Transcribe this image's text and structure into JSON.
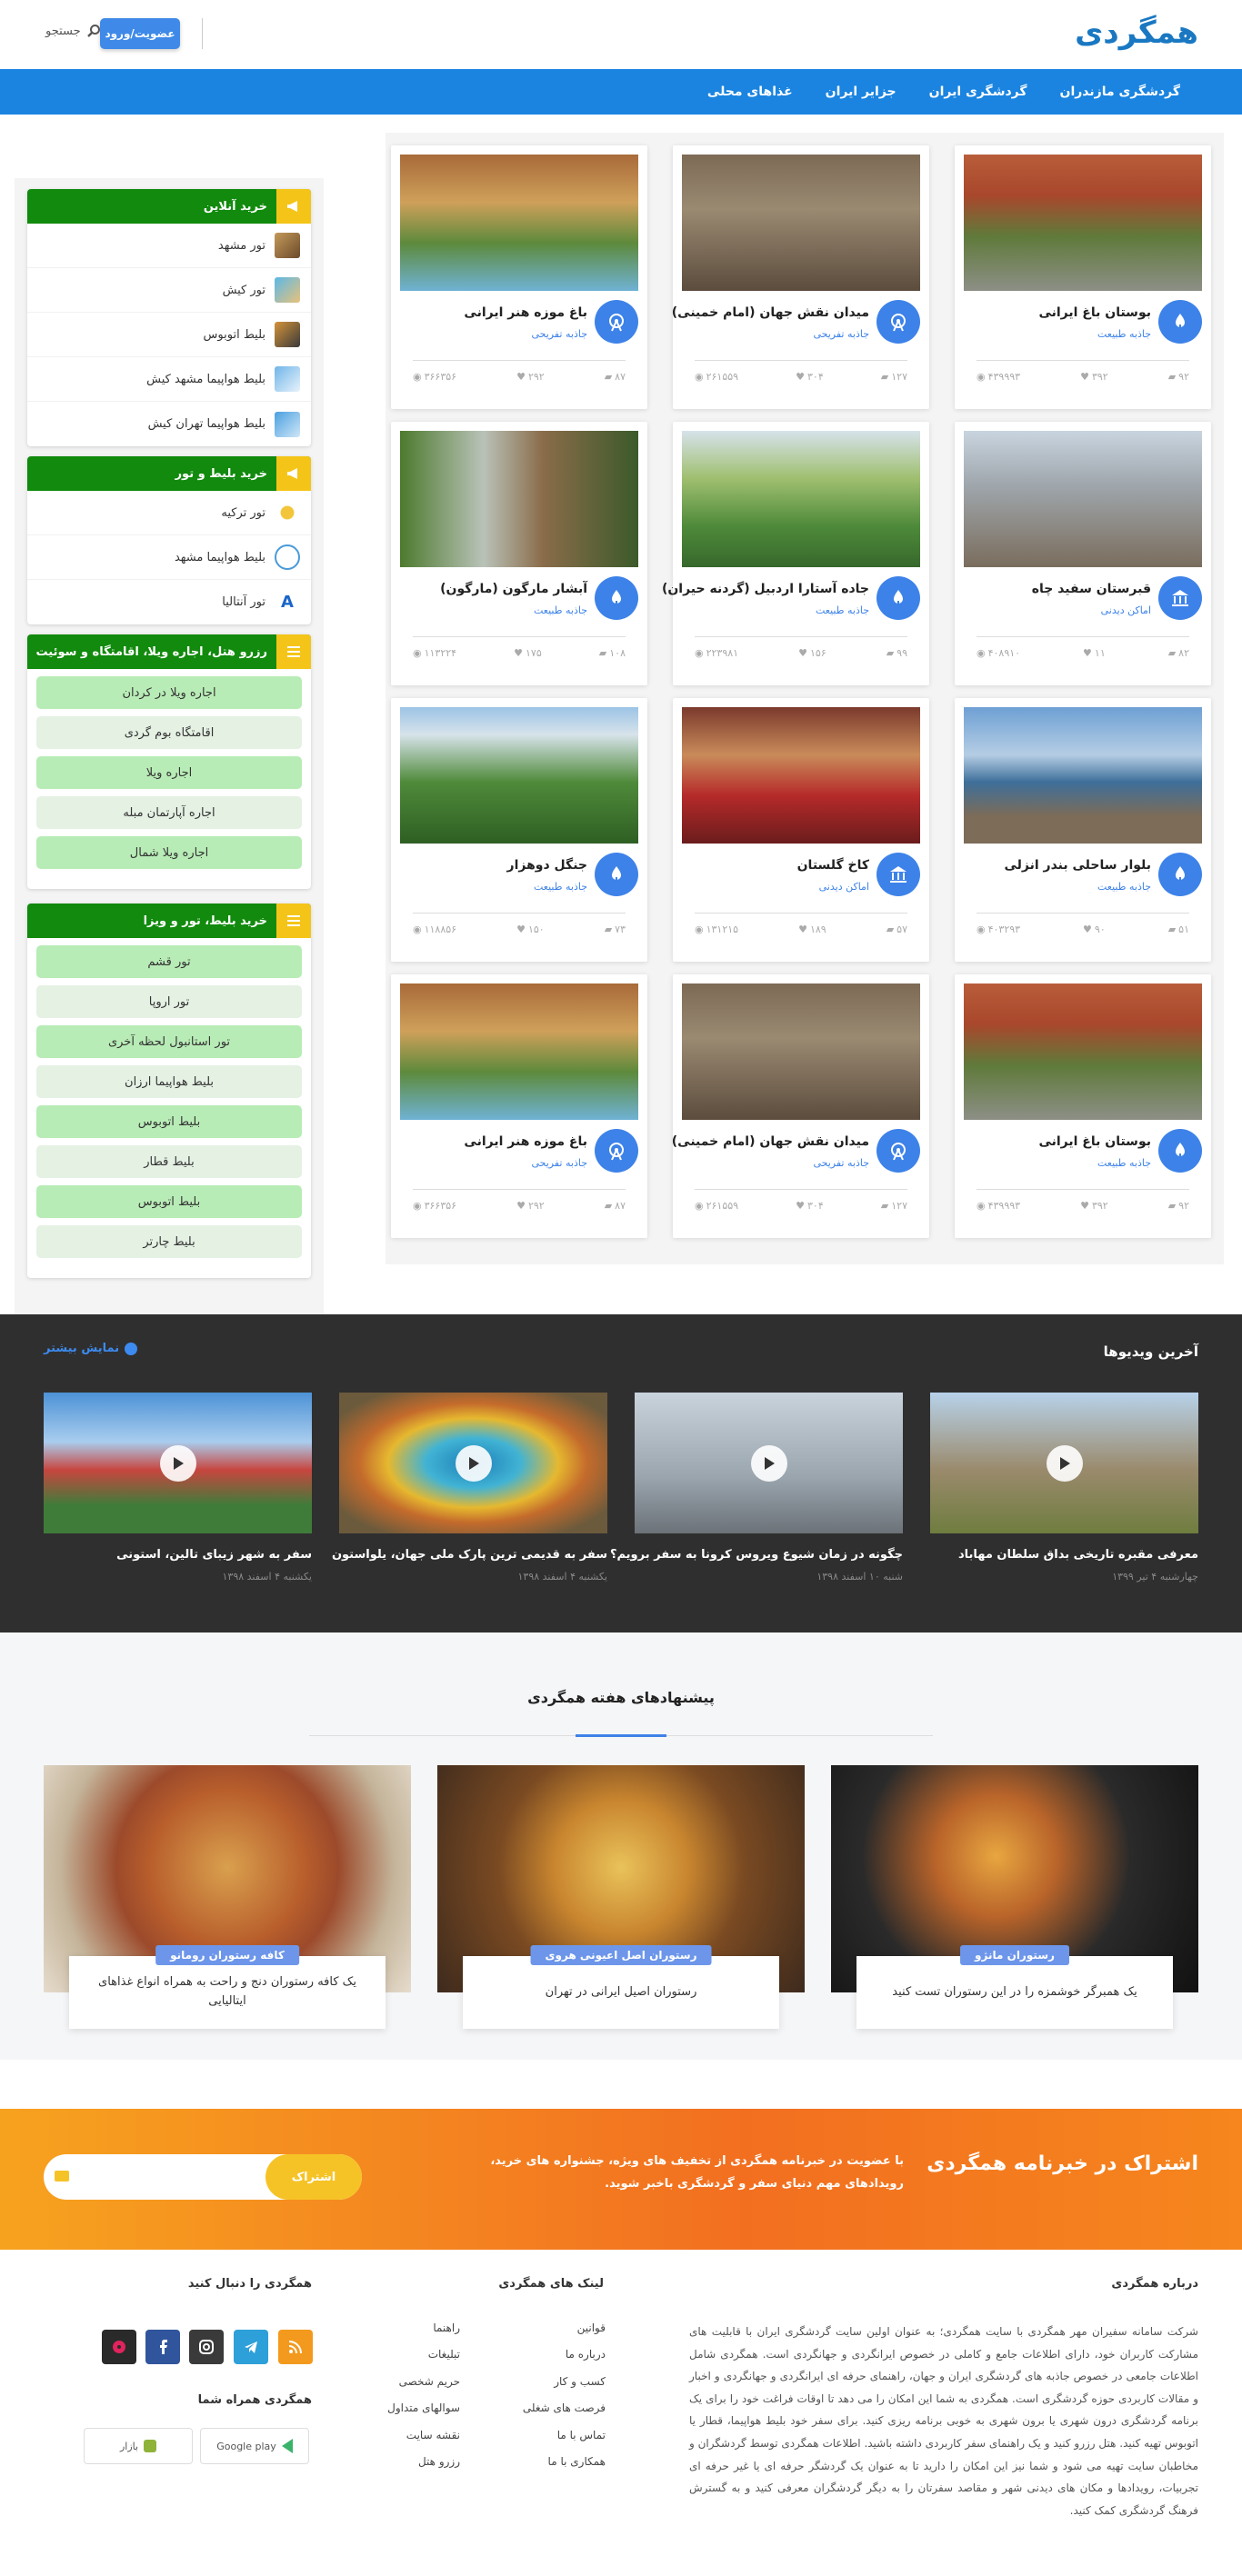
{
  "header": {
    "logo_text": "همگردی",
    "login_label": "عضویت/ورود",
    "search_label": "جستجو"
  },
  "nav": [
    "گردشگری مازندران",
    "گردشگری ایران",
    "جزایر ایران",
    "غذاهای محلی"
  ],
  "cards": [
    {
      "title": "بوستان باغ ایرانی",
      "category": "جاذبه طبیعت",
      "views": "۴۳۹۹۹۳",
      "likes": "۳۹۲",
      "comments": "۹۲",
      "icon": "nature-icon",
      "img": "a"
    },
    {
      "title": "میدان نقش جهان (امام خمینی)",
      "category": "جاذبه تفریحی",
      "views": "۲۶۱۵۵۹",
      "likes": "۳۰۴",
      "comments": "۱۲۷",
      "icon": "ferris-wheel-icon",
      "img": "b"
    },
    {
      "title": "باغ موزه هنر ایرانی",
      "category": "جاذبه تفریحی",
      "views": "۳۶۶۳۵۶",
      "likes": "۲۹۲",
      "comments": "۸۷",
      "icon": "ferris-wheel-icon",
      "img": "c"
    },
    {
      "title": "قبرستان سفید چاه",
      "category": "اماکن دیدنی",
      "views": "۴۰۸۹۱۰",
      "likes": "۱۱",
      "comments": "۸۲",
      "icon": "museum-icon",
      "img": "d"
    },
    {
      "title": "جاده آستارا اردبیل (گردنه حیران)",
      "category": "جاذبه طبیعت",
      "views": "۲۲۳۹۸۱",
      "likes": "۱۵۶",
      "comments": "۹۹",
      "icon": "nature-icon",
      "img": "e"
    },
    {
      "title": "آبشار مارگون (مارگون)",
      "category": "جاذبه طبیعت",
      "views": "۱۱۳۲۲۴",
      "likes": "۱۷۵",
      "comments": "۱۰۸",
      "icon": "nature-icon",
      "img": "f"
    },
    {
      "title": "بلوار ساحلی بندر انزلی",
      "category": "جاذبه طبیعت",
      "views": "۴۰۳۲۹۳",
      "likes": "۹۰",
      "comments": "۵۱",
      "icon": "nature-icon",
      "img": "g"
    },
    {
      "title": "کاخ گلستان",
      "category": "اماکن دیدنی",
      "views": "۱۳۱۲۱۵",
      "likes": "۱۸۹",
      "comments": "۵۷",
      "icon": "museum-icon",
      "img": "h"
    },
    {
      "title": "جنگل دوهزار",
      "category": "جاذبه طبیعت",
      "views": "۱۱۸۸۵۶",
      "likes": "۱۵۰",
      "comments": "۷۳",
      "icon": "nature-icon",
      "img": "i"
    },
    {
      "title": "بوستان باغ ایرانی",
      "category": "جاذبه طبیعت",
      "views": "۴۳۹۹۹۳",
      "likes": "۳۹۲",
      "comments": "۹۲",
      "icon": "nature-icon",
      "img": "a"
    },
    {
      "title": "میدان نقش جهان (امام خمینی)",
      "category": "جاذبه تفریحی",
      "views": "۲۶۱۵۵۹",
      "likes": "۳۰۴",
      "comments": "۱۲۷",
      "icon": "ferris-wheel-icon",
      "img": "b"
    },
    {
      "title": "باغ موزه هنر ایرانی",
      "category": "جاذبه تفریحی",
      "views": "۳۶۶۳۵۶",
      "likes": "۲۹۲",
      "comments": "۸۷",
      "icon": "ferris-wheel-icon",
      "img": "c"
    }
  ],
  "sidebar": {
    "online": {
      "title": "خرید آنلاین",
      "items": [
        "تور مشهد",
        "تور کیش",
        "بلیط اتوبوس",
        "بلیط هواپیما مشهد کیش",
        "بلیط هواپیما تهران کیش"
      ]
    },
    "ticket": {
      "title": "خرید بلیط و تور",
      "items": [
        "تور ترکیه",
        "بلیط هواپیما مشهد",
        "تور آنتالیا"
      ]
    },
    "hotel": {
      "title": "رزرو هتل، اجاره ویلا، اقامتگاه و سوئیت",
      "items": [
        "اجاره ویلا در کردان",
        "اقامتگاه بوم گردی",
        "اجاره ویلا",
        "اجاره آپارتمان مبله",
        "اجاره ویلا شمال"
      ]
    },
    "visa": {
      "title": "خرید بلیط، تور و ویزا",
      "items": [
        "تور قشم",
        "تور اروپا",
        "تور استانبول لحظه آخری",
        "بلیط هواپیما ارزان",
        "بلیط اتوبوس",
        "بلیط قطار",
        "بلیط اتوبوس",
        "بلیط چارتر"
      ]
    }
  },
  "videos": {
    "title": "آخرین ویدیوها",
    "more": "نمایش بیشتر",
    "items": [
      {
        "title": "معرفی مقبره تاریخی بداق سلطان مهاباد",
        "date": "چهارشنبه ۴ تیر ۱۳۹۹"
      },
      {
        "title": "چگونه در زمان شیوع ویروس کرونا به سفر برویم؟",
        "date": "شنبه ۱۰ اسفند ۱۳۹۸"
      },
      {
        "title": "سفر به قدیمی ترین پارک ملی جهان، یلواستون",
        "date": "یکشنبه ۴ اسفند ۱۳۹۸"
      },
      {
        "title": "سفر به شهر زیبای تالین، استونی",
        "date": "یکشنبه ۴ اسفند ۱۳۹۸"
      }
    ]
  },
  "suggestions": {
    "title": "پیشنهادهای هفته همگردی",
    "items": [
      {
        "badge": "رستوران مانژو",
        "text": "یک همبرگر خوشمزه را در این رستوران تست کنید"
      },
      {
        "badge": "رستوران اصل اعیونی هروی",
        "text": "رستوران اصیل ایرانی در تهران"
      },
      {
        "badge": "کافه رستوران رومانو",
        "text": "یک کافه رستوران دنج و راحت به همراه انواع غذاهای ایتالیایی"
      }
    ]
  },
  "newsletter": {
    "title": "اشتراک در خبرنامه همگردی",
    "desc": "با عضویت در خبرنامه همگردی از تخفیف های ویژه، جشنواره های خرید، رویدادهای مهم دنیای سفر و گردشگری باخبر شوید.",
    "button": "اشتراک"
  },
  "footer": {
    "about_title": "درباره همگردی",
    "about_text": "شرکت سامانه سفیران مهر همگردی با سایت همگردی؛ به عنوان اولین سایت گردشگری ایران با قابلیت های مشارکت کاربران خود، دارای اطلاعات جامع و کاملی در خصوص ایرانگردی و جهانگردی است. همگردی شامل اطلاعات جامعی در خصوص جاذبه های گردشگری ایران و جهان، راهنمای حرفه ای ایرانگردی و جهانگردی و اخبار و مقالات کاربردی حوزه گردشگری است. همگردی به شما این امکان را می دهد تا اوقات فراغت خود را برای یک برنامه گردشگری درون شهری یا برون شهری به خوبی برنامه ریزی کنید. برای سفر خود بلیط هواپیما، قطار یا اتوبوس تهیه کنید. هتل رزرو کنید و یک راهنمای سفر کاربردی داشته باشید. اطلاعات همگردی توسط گردشگران و مخاطبان سایت تهیه می شود و شما نیز این امکان را دارید تا به عنوان یک گردشگر حرفه ای یا غیر حرفه ای تجربیات، رویدادها و مکان های دیدنی شهر و مقاصد سفرتان را به دیگر گردشگران معرفی کنید و به گسترش فرهنگ گردشگری کمک کنید.",
    "links_title": "لینک های همگردی",
    "links_col1": [
      "قوانین",
      "درباره ما",
      "کسب و کار",
      "فرصت های شغلی",
      "تماس با ما",
      "همکاری با ما"
    ],
    "links_col2": [
      "راهنما",
      "تبلیغات",
      "حریم شخصی",
      "سوالهای متداول",
      "نقشه سایت",
      "رزرو هتل"
    ],
    "follow_title": "همگردی را دنبال کنید",
    "app_title": "همگردی همراه شما",
    "store1": "Google play",
    "store2": "بازار"
  }
}
